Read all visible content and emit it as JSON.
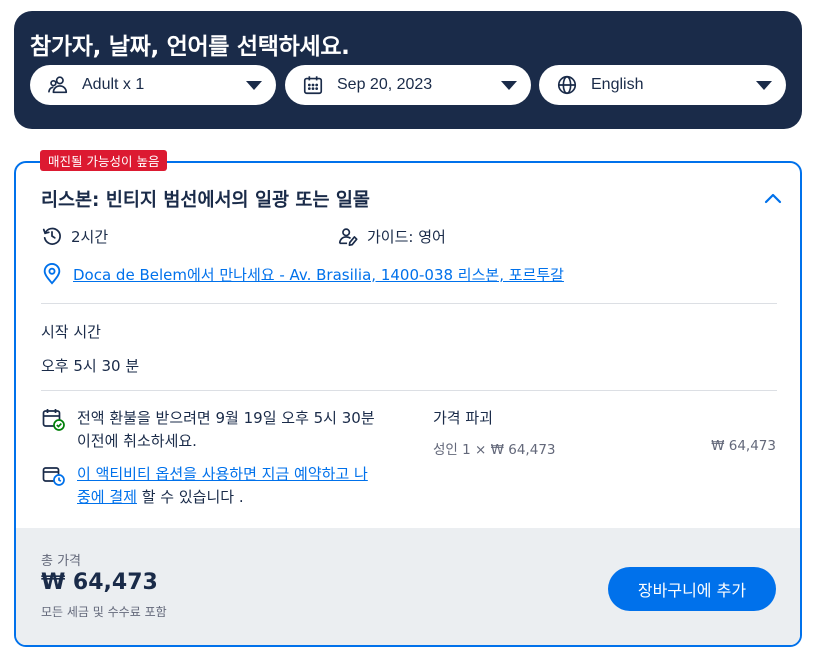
{
  "header": {
    "title": "참가자, 날짜, 언어를 선택하세요.",
    "participants": {
      "value": "Adult x 1",
      "icon": "participants-icon"
    },
    "date": {
      "value": "Sep 20, 2023",
      "icon": "calendar-icon"
    },
    "language": {
      "value": "English",
      "icon": "globe-icon"
    }
  },
  "option": {
    "badge": "매진될 가능성이 높음",
    "title": "리스본: 빈티지 범선에서의 일광 또는 일몰",
    "duration": "2시간",
    "guide": "가이드: 영어",
    "meeting_point": "Doca de Belem에서 만나세요 - Av. Brasilia, 1400-038 리스본, 포르투갈",
    "start_time_label": "시작 시간",
    "start_time_value": "오후 5시 30 분",
    "refund_text": "전액 환불을 받으려면 9월 19일 오후 5시 30분 이전에 취소하세요.",
    "pay_later_link": "이 액티비티 옵션을 사용하면 지금 예약하고 나중에 결제",
    "pay_later_suffix": " 할 수 있습니다 .",
    "price_breakdown_title": "가격 파괴",
    "price_line_label": "성인 1 × ₩ 64,473",
    "price_line_value": "₩ 64,473"
  },
  "footer": {
    "total_label": "총 가격",
    "total_price": "₩ 64,473",
    "tax_note": "모든 세금 및 수수료 포함",
    "add_to_cart": "장바구니에 추가"
  },
  "colors": {
    "navy": "#1a2b49",
    "accent_blue": "#0071eb",
    "badge_red": "#dc1a31",
    "footer_bg": "#ebeef1"
  }
}
